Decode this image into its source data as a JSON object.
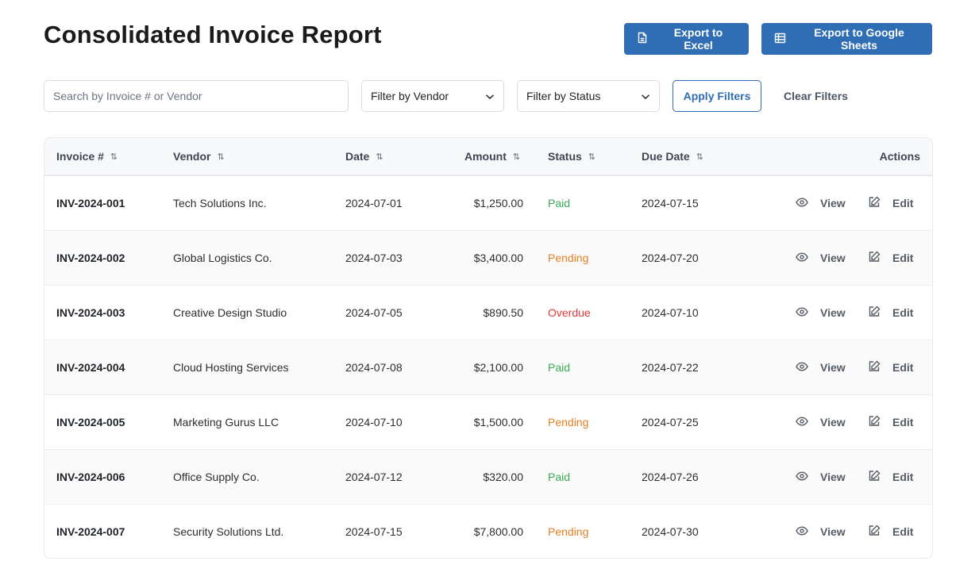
{
  "header": {
    "title": "Consolidated Invoice Report",
    "export_excel_label": "Export to Excel",
    "export_sheets_label": "Export to Google Sheets"
  },
  "filters": {
    "search_placeholder": "Search by Invoice # or Vendor",
    "vendor_select": "Filter by Vendor",
    "status_select": "Filter by Status",
    "apply_label": "Apply Filters",
    "clear_label": "Clear Filters"
  },
  "table": {
    "columns": {
      "invoice": "Invoice #",
      "vendor": "Vendor",
      "date": "Date",
      "amount": "Amount",
      "status": "Status",
      "due_date": "Due Date",
      "actions": "Actions"
    },
    "sort_glyph": "⇅",
    "view_label": "View",
    "edit_label": "Edit",
    "rows": [
      {
        "invoice": "INV-2024-001",
        "vendor": "Tech Solutions Inc.",
        "date": "2024-07-01",
        "amount": "$1,250.00",
        "status": "Paid",
        "due_date": "2024-07-15"
      },
      {
        "invoice": "INV-2024-002",
        "vendor": "Global Logistics Co.",
        "date": "2024-07-03",
        "amount": "$3,400.00",
        "status": "Pending",
        "due_date": "2024-07-20"
      },
      {
        "invoice": "INV-2024-003",
        "vendor": "Creative Design Studio",
        "date": "2024-07-05",
        "amount": "$890.50",
        "status": "Overdue",
        "due_date": "2024-07-10"
      },
      {
        "invoice": "INV-2024-004",
        "vendor": "Cloud Hosting Services",
        "date": "2024-07-08",
        "amount": "$2,100.00",
        "status": "Paid",
        "due_date": "2024-07-22"
      },
      {
        "invoice": "INV-2024-005",
        "vendor": "Marketing Gurus LLC",
        "date": "2024-07-10",
        "amount": "$1,500.00",
        "status": "Pending",
        "due_date": "2024-07-25"
      },
      {
        "invoice": "INV-2024-006",
        "vendor": "Office Supply Co.",
        "date": "2024-07-12",
        "amount": "$320.00",
        "status": "Paid",
        "due_date": "2024-07-26"
      },
      {
        "invoice": "INV-2024-007",
        "vendor": "Security Solutions Ltd.",
        "date": "2024-07-15",
        "amount": "$7,800.00",
        "status": "Pending",
        "due_date": "2024-07-30"
      }
    ]
  },
  "colors": {
    "primary": "#2f6db4",
    "paid": "#3aaa55",
    "pending": "#e67e22",
    "overdue": "#dc3b3b"
  },
  "icons": {
    "excel": "document-icon",
    "sheets": "spreadsheet-grid-icon",
    "select": "chevron-down-icon",
    "view": "eye-icon",
    "edit": "edit-icon"
  }
}
